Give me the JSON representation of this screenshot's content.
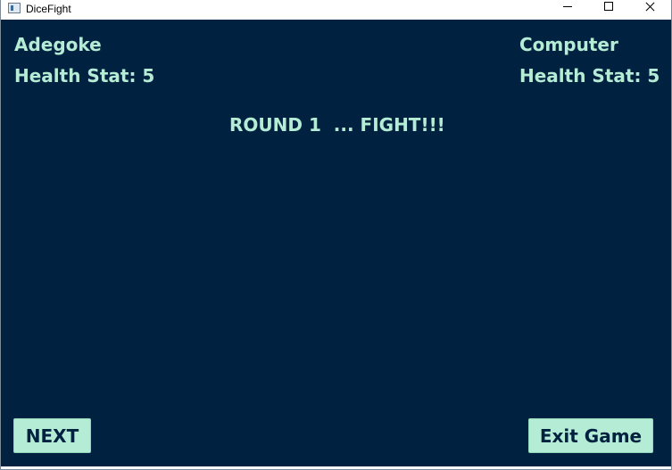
{
  "window": {
    "title": "DiceFight"
  },
  "player": {
    "name": "Adegoke",
    "health_text": "Health Stat: 5"
  },
  "opponent": {
    "name": "Computer",
    "health_text": "Health Stat: 5"
  },
  "round_text": "ROUND 1  ... FIGHT!!!",
  "buttons": {
    "next": "NEXT",
    "exit": "Exit Game"
  },
  "colors": {
    "background": "#002240",
    "text": "#b5ecd5",
    "button_bg": "#b5ecd5",
    "button_text": "#002240"
  }
}
